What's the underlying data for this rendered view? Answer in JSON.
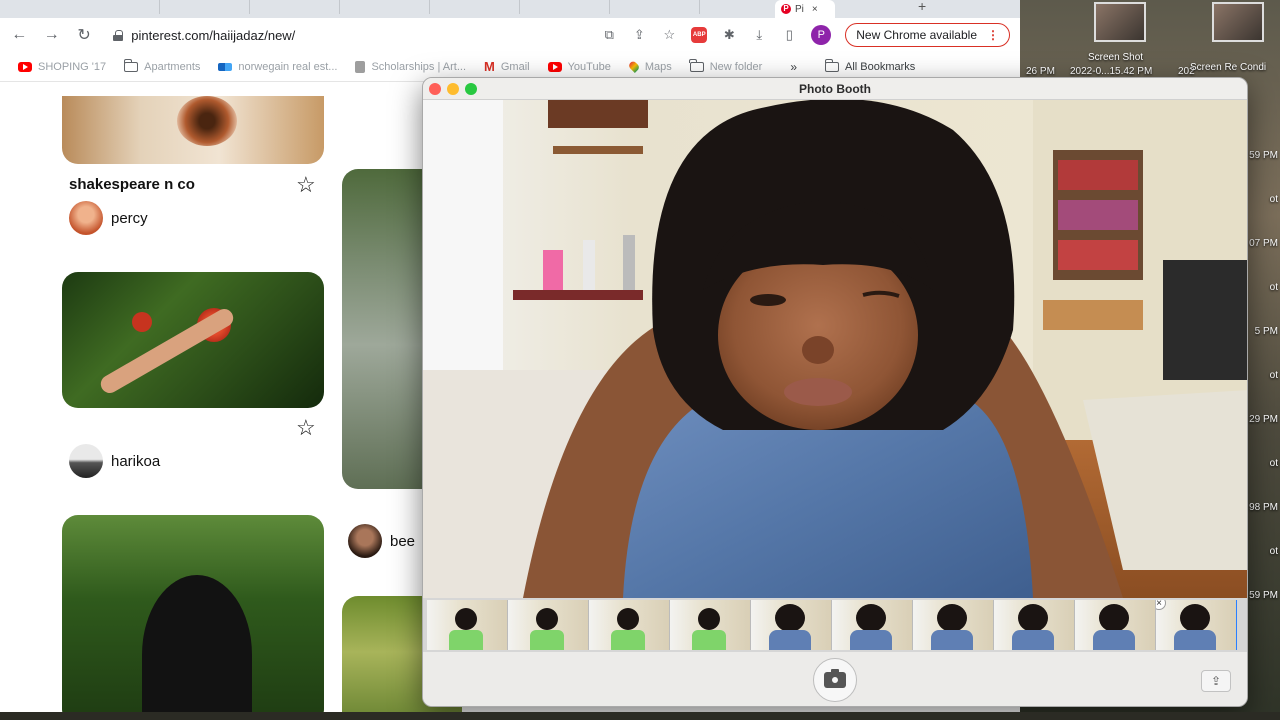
{
  "browser": {
    "url": "pinterest.com/haiijadaz/new/",
    "active_tab_label": "Pi",
    "profile_initial": "P",
    "update_label": "New Chrome available",
    "bookmarks": [
      {
        "label": "SHOPING '17",
        "icon": "youtube-icon"
      },
      {
        "label": "Apartments",
        "icon": "folder-icon"
      },
      {
        "label": "norwegain real est...",
        "icon": "blue-bookmark-icon"
      },
      {
        "label": "Scholarships | Art...",
        "icon": "bookmark-icon"
      },
      {
        "label": "Gmail",
        "icon": "gmail-icon"
      },
      {
        "label": "YouTube",
        "icon": "youtube-icon"
      },
      {
        "label": "Maps",
        "icon": "maps-icon"
      },
      {
        "label": "New folder",
        "icon": "folder-icon"
      }
    ],
    "bookmarks_more": "»",
    "all_bookmarks": "All Bookmarks"
  },
  "pins": {
    "pin1_title": "shakespeare n co",
    "pin1_user": "percy",
    "pin2_user": "harikoa",
    "pin3_user": "bee"
  },
  "photobooth": {
    "title": "Photo Booth",
    "thumbnail_count": 10,
    "selected_thumbnail": 10
  },
  "desktop": {
    "label1": "Screen Shot",
    "label2": "26 PM",
    "label3": "2022-0...15.42 PM",
    "label4": "202",
    "label5": "Screen Re Condi",
    "right_times": [
      "59 PM",
      "ot",
      "07 PM",
      "ot",
      "5 PM",
      "ot",
      "29 PM",
      "ot",
      "98 PM",
      "ot",
      "59 PM"
    ]
  },
  "colors": {
    "pinterest_red": "#e60023",
    "update_border": "#d93025",
    "selection_blue": "#2a7fff"
  }
}
